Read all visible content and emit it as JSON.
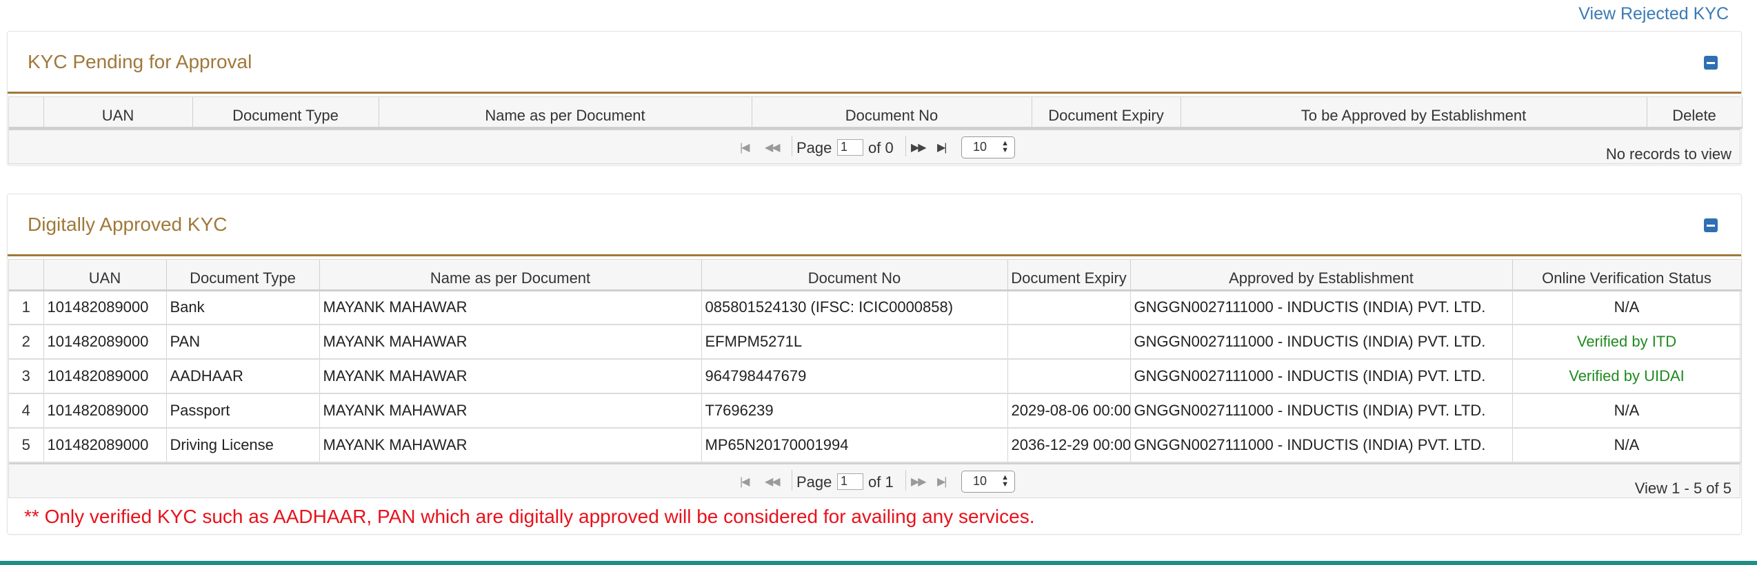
{
  "top_link": "View Rejected KYC",
  "pending": {
    "title": "KYC Pending for Approval",
    "columns": [
      "",
      "UAN",
      "Document Type",
      "Name as per Document",
      "Document No",
      "Document Expiry",
      "To be Approved by Establishment",
      "Delete"
    ],
    "pager": {
      "page_label": "Page",
      "page_value": "1",
      "of_label": "of 0",
      "rows_per_page": "10",
      "info": "No records to view"
    }
  },
  "approved": {
    "title": "Digitally Approved KYC",
    "columns": [
      "",
      "UAN",
      "Document Type",
      "Name as per Document",
      "Document No",
      "Document Expiry",
      "Approved by Establishment",
      "Online Verification Status"
    ],
    "rows": [
      {
        "n": "1",
        "uan": "101482089000",
        "type": "Bank",
        "name": "MAYANK MAHAWAR",
        "docno": "085801524130 (IFSC: ICIC0000858)",
        "expiry": "",
        "est": "GNGGN0027111000 - INDUCTIS (INDIA) PVT. LTD.",
        "status": "N/A"
      },
      {
        "n": "2",
        "uan": "101482089000",
        "type": "PAN",
        "name": "MAYANK MAHAWAR",
        "docno": "EFMPM5271L",
        "expiry": "",
        "est": "GNGGN0027111000 - INDUCTIS (INDIA) PVT. LTD.",
        "status": "Verified by ITD"
      },
      {
        "n": "3",
        "uan": "101482089000",
        "type": "AADHAAR",
        "name": "MAYANK MAHAWAR",
        "docno": "964798447679",
        "expiry": "",
        "est": "GNGGN0027111000 - INDUCTIS (INDIA) PVT. LTD.",
        "status": "Verified by UIDAI"
      },
      {
        "n": "4",
        "uan": "101482089000",
        "type": "Passport",
        "name": "MAYANK MAHAWAR",
        "docno": "T7696239",
        "expiry": "2029-08-06 00:00",
        "est": "GNGGN0027111000 - INDUCTIS (INDIA) PVT. LTD.",
        "status": "N/A"
      },
      {
        "n": "5",
        "uan": "101482089000",
        "type": "Driving License",
        "name": "MAYANK MAHAWAR",
        "docno": "MP65N20170001994",
        "expiry": "2036-12-29 00:00",
        "est": "GNGGN0027111000 - INDUCTIS (INDIA) PVT. LTD.",
        "status": "N/A"
      }
    ],
    "pager": {
      "page_label": "Page",
      "page_value": "1",
      "of_label": "of 1",
      "rows_per_page": "10",
      "info": "View 1 - 5 of 5"
    }
  },
  "note": "** Only verified KYC such as AADHAAR, PAN which are digitally approved will be considered for availing any services.",
  "colors": {
    "accent_title": "#a0783a",
    "link": "#3a7ab5",
    "verified": "#1f8a1f",
    "note": "#e8111b",
    "footer_bar": "#1d8f87"
  }
}
